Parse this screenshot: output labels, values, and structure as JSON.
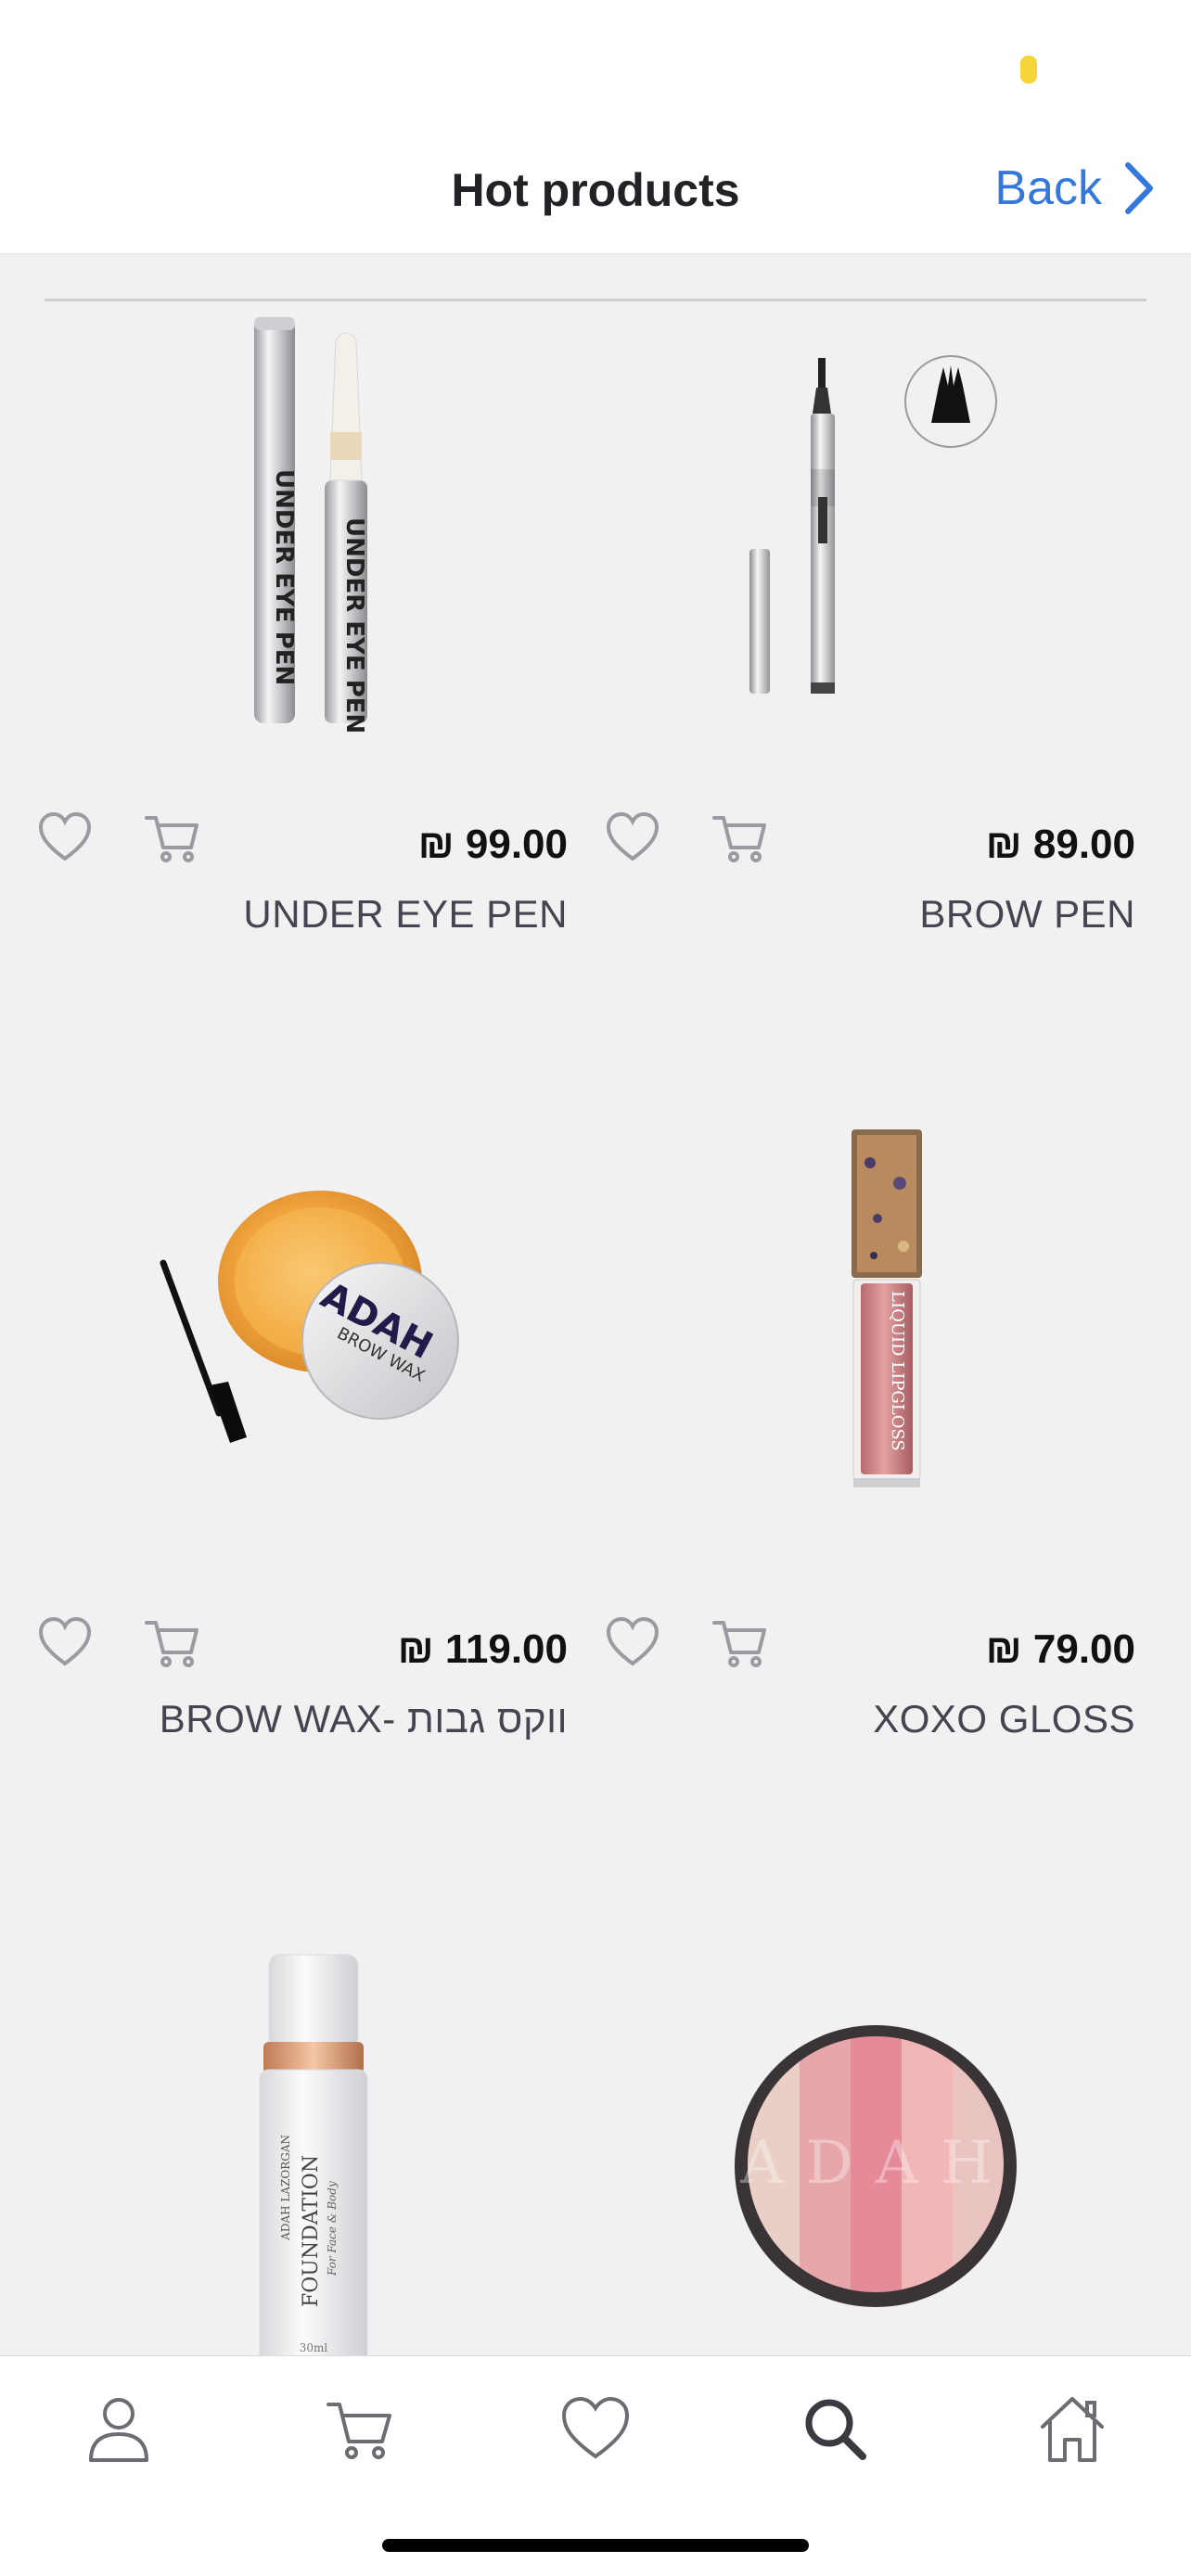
{
  "header": {
    "title": "Hot products",
    "back_label": "Back"
  },
  "products": [
    {
      "name": "UNDER EYE PEN",
      "price": "₪ 99.00",
      "image": "under-eye-pen"
    },
    {
      "name": "BROW PEN",
      "price": "₪ 89.00",
      "image": "brow-pen"
    },
    {
      "name": "BROW WAX- ווקס גבות",
      "price": "₪ 119.00",
      "image": "brow-wax",
      "image_text": [
        "ADAH",
        "BROW WAX"
      ]
    },
    {
      "name": "XOXO GLOSS",
      "price": "₪ 79.00",
      "image": "liquid-lipgloss",
      "image_text": [
        "LIQUID LIPGLOSS"
      ]
    },
    {
      "name": "",
      "price": "",
      "image": "foundation",
      "image_text": [
        "ADAH LAZORGAN",
        "FOUNDATION",
        "For Face & Body",
        "30ml"
      ]
    },
    {
      "name": "",
      "price": "",
      "image": "blush-compact",
      "image_text": [
        "ADAH"
      ]
    }
  ],
  "tabs": [
    {
      "name": "profile",
      "icon": "person-icon"
    },
    {
      "name": "cart",
      "icon": "cart-icon"
    },
    {
      "name": "favorites",
      "icon": "heart-icon"
    },
    {
      "name": "search",
      "icon": "search-icon"
    },
    {
      "name": "home",
      "icon": "home-icon"
    }
  ],
  "colors": {
    "accent": "#3478dc",
    "background": "#f1f1f2",
    "icon_gray": "#9a9aa0"
  }
}
